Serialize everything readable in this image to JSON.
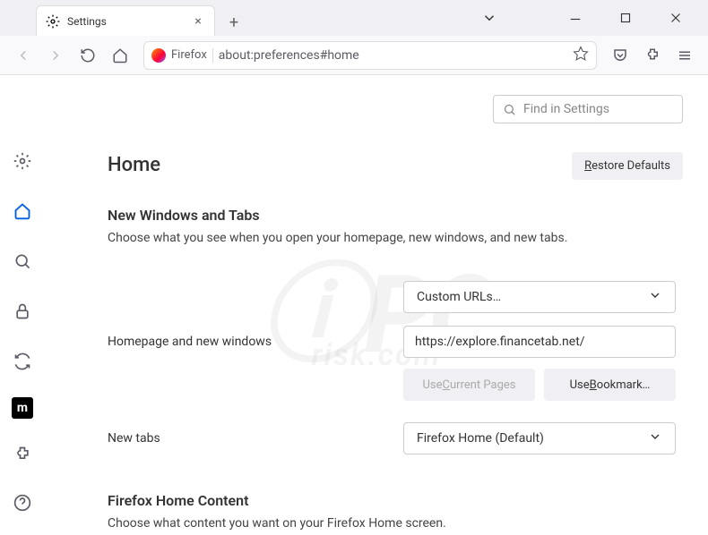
{
  "tab": {
    "label": "Settings"
  },
  "urlbar": {
    "identity": "Firefox",
    "url": "about:preferences#home"
  },
  "search": {
    "placeholder": "Find in Settings"
  },
  "page": {
    "title": "Home"
  },
  "restore_btn": {
    "label": "Restore Defaults",
    "accesskey": "R"
  },
  "section1": {
    "title": "New Windows and Tabs",
    "desc": "Choose what you see when you open your homepage, new windows, and new tabs."
  },
  "homepage": {
    "label": "Homepage and new windows",
    "select_value": "Custom URLs…",
    "url_value": "https://explore.financetab.net/",
    "use_current": "Use Current Pages",
    "use_bookmark": "Use Bookmark…",
    "accesskey_current": "C",
    "accesskey_bookmark": "B"
  },
  "newtabs": {
    "label": "New tabs",
    "select_value": "Firefox Home (Default)"
  },
  "section2": {
    "title": "Firefox Home Content",
    "desc": "Choose what content you want on your Firefox Home screen."
  }
}
